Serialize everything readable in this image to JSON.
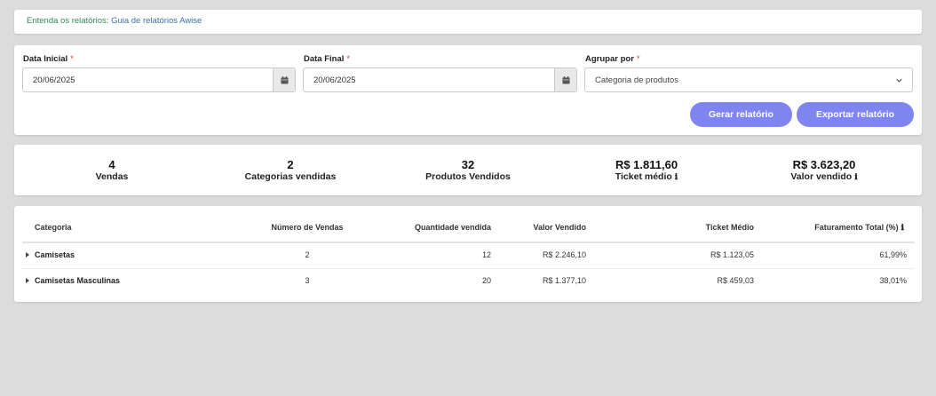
{
  "banner": {
    "text": "Entenda os relatórios: ",
    "link": "Guia de relatórios Awise"
  },
  "filters": {
    "start_label": "Data Inicial",
    "start_value": "20/06/2025",
    "end_label": "Data Final",
    "end_value": "20/06/2025",
    "group_label": "Agrupar por",
    "group_value": "Categoria de produtos",
    "required_mark": "*"
  },
  "buttons": {
    "generate": "Gerar relatório",
    "export": "Exportar relatório"
  },
  "colors": {
    "accent": "#7f85f0",
    "banner_text": "#2e8b57",
    "banner_link": "#3a6fb0",
    "required": "#e53935"
  },
  "stats": [
    {
      "value": "4",
      "label": "Vendas",
      "info": false
    },
    {
      "value": "2",
      "label": "Categorias vendidas",
      "info": false
    },
    {
      "value": "32",
      "label": "Produtos Vendidos",
      "info": false
    },
    {
      "value": "R$ 1.811,60",
      "label": "Ticket médio",
      "info": true
    },
    {
      "value": "R$ 3.623,20",
      "label": "Valor vendido",
      "info": true
    }
  ],
  "info_glyph": "ℹ",
  "table": {
    "headers": [
      "Categoria",
      "Número de Vendas",
      "Quantidade vendida",
      "Valor Vendido",
      "Ticket Médio",
      "Faturamento Total (%)"
    ],
    "rows": [
      [
        "Camisetas",
        "2",
        "12",
        "R$ 2.246,10",
        "R$ 1.123,05",
        "61,99%"
      ],
      [
        "Camisetas Masculinas",
        "3",
        "20",
        "R$ 1.377,10",
        "R$ 459,03",
        "38,01%"
      ]
    ]
  }
}
